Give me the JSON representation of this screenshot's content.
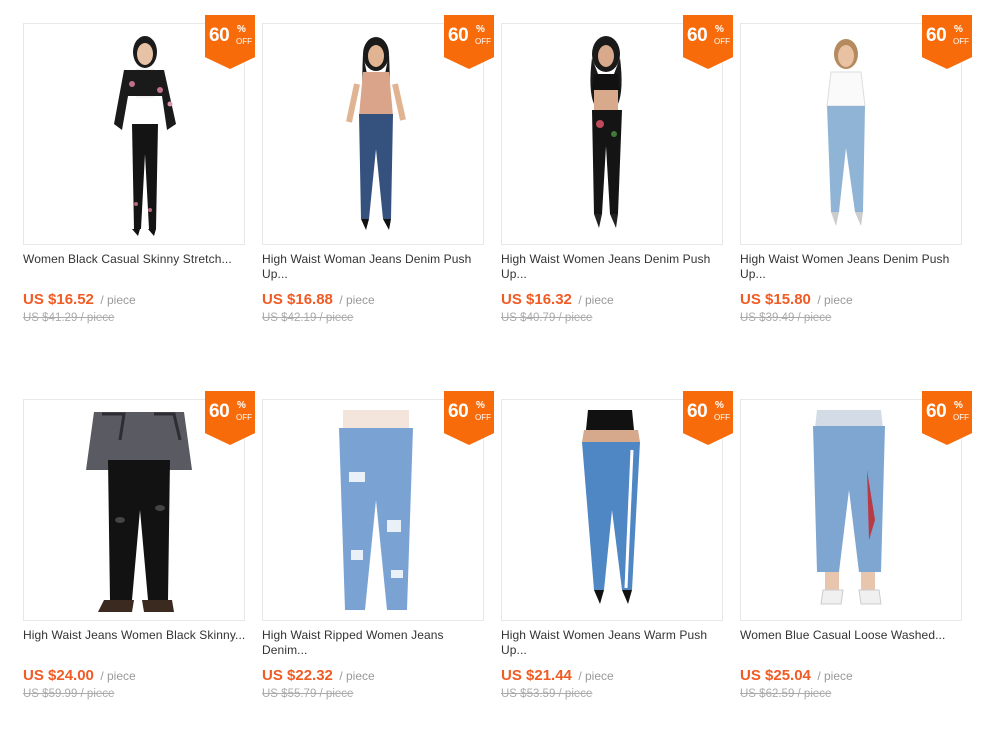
{
  "badge": {
    "percent": "60",
    "symbol": "%",
    "off": "OFF"
  },
  "unit": "/ piece",
  "products": [
    {
      "title_line1": "Women Black Casual Skinny Stretch...",
      "title_line2": "",
      "price": "US $16.52",
      "original": "US $41.29 / piece",
      "image": "woman-black-jeans-floral-jacket"
    },
    {
      "title_line1": "High Waist Woman Jeans Denim Push",
      "title_line2": "Up...",
      "price": "US $16.88",
      "original": "US $42.19 / piece",
      "image": "woman-dark-blue-jeans-bodysuit"
    },
    {
      "title_line1": "High Waist Women Jeans Denim Push",
      "title_line2": "Up...",
      "price": "US $16.32",
      "original": "US $40.79 / piece",
      "image": "woman-black-embroidered-jeans"
    },
    {
      "title_line1": "High Waist Women Jeans Denim Push",
      "title_line2": "Up...",
      "price": "US $15.80",
      "original": "US $39.49 / piece",
      "image": "woman-light-blue-jeans-white-top"
    },
    {
      "title_line1": "High Waist Jeans Women Black Skinny...",
      "title_line2": "",
      "price": "US $24.00",
      "original": "US $59.99 / piece",
      "image": "black-ripped-skinny-jeans"
    },
    {
      "title_line1": "High Waist Ripped Women Jeans",
      "title_line2": "Denim...",
      "price": "US $22.32",
      "original": "US $55.79 / piece",
      "image": "light-blue-ripped-jeans"
    },
    {
      "title_line1": "High Waist Women Jeans Warm Push",
      "title_line2": "Up...",
      "price": "US $21.44",
      "original": "US $53.59 / piece",
      "image": "blue-jeans-side-stripe"
    },
    {
      "title_line1": "Women Blue Casual Loose Washed...",
      "title_line2": "",
      "price": "US $25.04",
      "original": "US $62.59 / piece",
      "image": "loose-blue-jeans-embroidered"
    }
  ],
  "colors": {
    "badge": "#f76b0a",
    "price": "#f15b24"
  }
}
